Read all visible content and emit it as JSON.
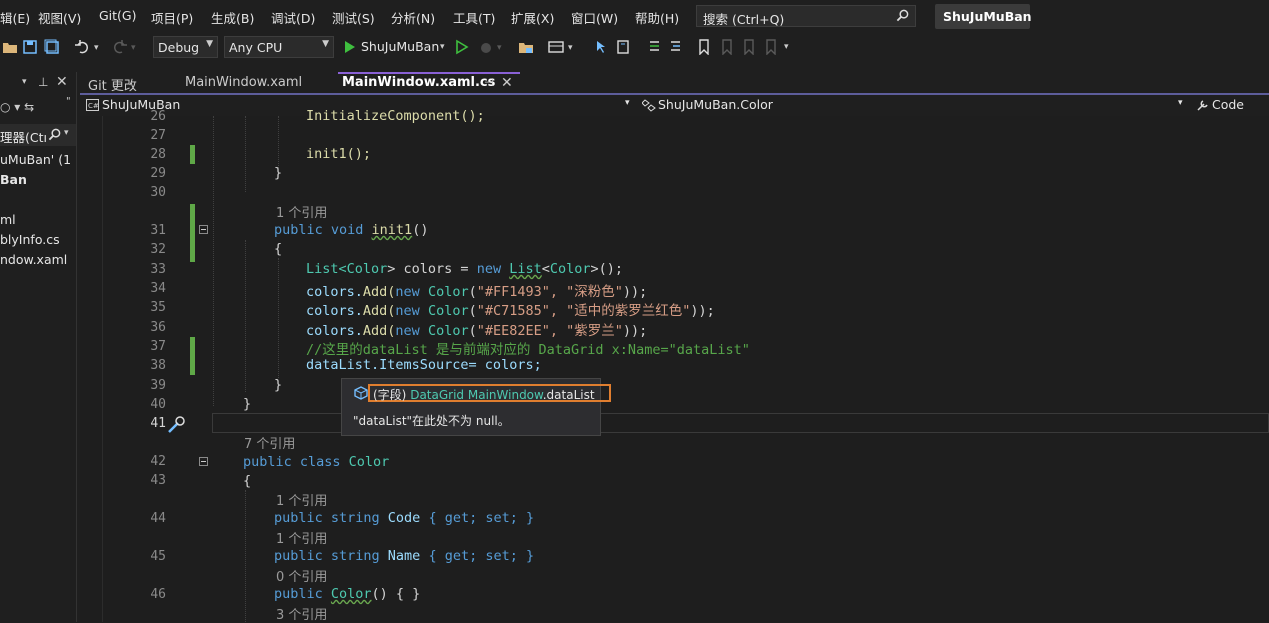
{
  "menubar": {
    "items": [
      "辑(E)",
      "视图(V)",
      "Git(G)",
      "项目(P)",
      "生成(B)",
      "调试(D)",
      "测试(S)",
      "分析(N)",
      "工具(T)",
      "扩展(X)",
      "窗口(W)",
      "帮助(H)"
    ],
    "search_label": "搜索 (Ctrl+Q)",
    "project_name": "ShuJuMuBan"
  },
  "toolbar": {
    "config": "Debug",
    "platform": "Any CPU",
    "run_target": "ShuJuMuBan"
  },
  "left_panel": {
    "items": [
      "理器(Ctı",
      "uMuBan' (1 ",
      "Ban",
      "ml",
      "blyInfo.cs",
      "ndow.xaml"
    ]
  },
  "tabs": {
    "git": "Git 更改",
    "xaml": "MainWindow.xaml",
    "active": "MainWindow.xaml.cs"
  },
  "navbar": {
    "project": "ShuJuMuBan",
    "type": "ShuJuMuBan.Color",
    "member": "Code"
  },
  "editor": {
    "lines": {
      "l26": "26",
      "l27": "27",
      "l28": "28",
      "l29": "29",
      "l30": "30",
      "l31": "31",
      "l32": "32",
      "l33": "33",
      "l34": "34",
      "l35": "35",
      "l36": "36",
      "l37": "37",
      "l38": "38",
      "l39": "39",
      "l40": "40",
      "l41": "41",
      "l42": "42",
      "l43": "43",
      "l44": "44",
      "l45": "45",
      "l46": "46"
    },
    "refs": {
      "r31": "1 个引用",
      "r42": "7 个引用",
      "r44": "1 个引用",
      "r45": "1 个引用",
      "r46": "0 个引用",
      "r47": "3 个引用"
    },
    "code": {
      "c26": "InitializeComponent();",
      "c28": "init1();",
      "c29": "}",
      "c31_kw": "public void ",
      "c31_name": "init1",
      "c31_rest": "()",
      "c32": "{",
      "c33_a": "List<",
      "c33_b": "Color",
      "c33_c": "> colors = ",
      "c33_d": "new ",
      "c33_e": "List",
      "c33_f": "<",
      "c33_g": "Color",
      "c33_h": ">();",
      "c34_a": "colors.",
      "c34_b": "Add(",
      "c34_c": "new ",
      "c34_d": "Color",
      "c34_e": "(",
      "c34_f": "\"#FF1493\", \"深粉色\"",
      "c34_g": "));",
      "c35_f": "\"#C71585\", \"适中的紫罗兰红色\"",
      "c36_f": "\"#EE82EE\", \"紫罗兰\"",
      "c37": "//这里的dataList 是与前端对应的 DataGrid x:Name=\"dataList\"",
      "c38": "dataList.ItemsSource= colors;",
      "c39": "}",
      "c40": "}",
      "c42_kw": "public class ",
      "c42_ty": "Color",
      "c43": "{",
      "c44_kw": "public string ",
      "c44_name": "Code ",
      "c44_acc": "{ get; set; }",
      "c45_name": "Name ",
      "c46_kw": "public ",
      "c46_name": "Color",
      "c46_rest": "() { }"
    }
  },
  "tooltip": {
    "kind": "(字段)",
    "type": "DataGrid",
    "owner": "MainWindow",
    "member": ".dataList",
    "note": "\"dataList\"在此处不为 null。"
  }
}
